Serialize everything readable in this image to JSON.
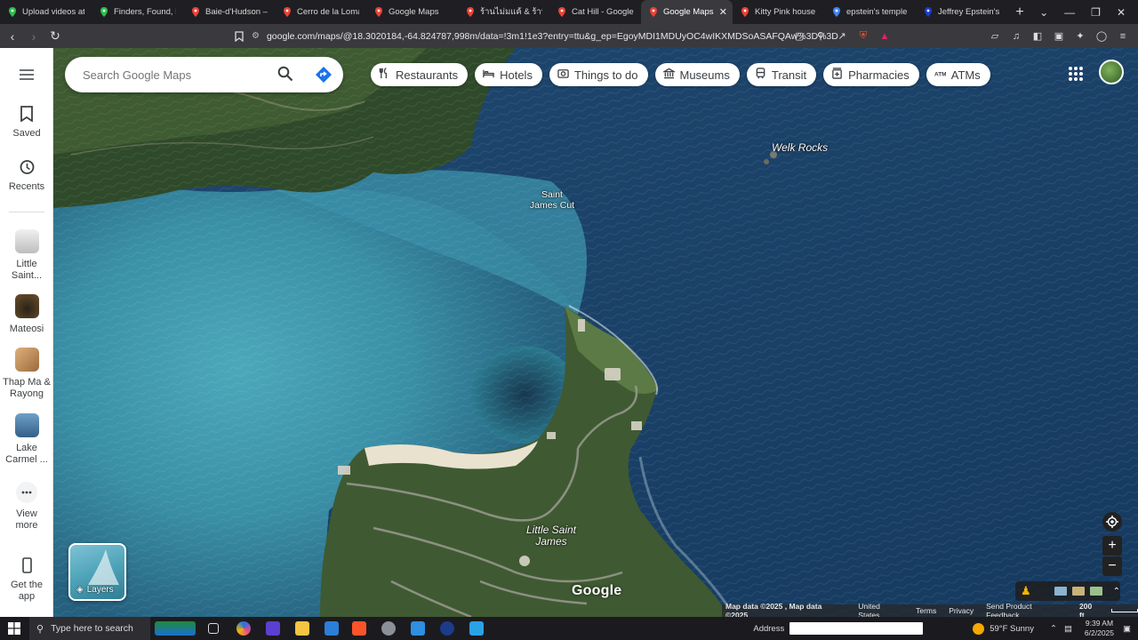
{
  "browser": {
    "tabs": [
      {
        "title": "Upload videos at R",
        "icon_color": "#2fbf4a"
      },
      {
        "title": "Finders, Found, Fur",
        "icon_color": "#2fbf4a"
      },
      {
        "title": "Baie-d'Hudson – Go",
        "icon_color": "#ea4335"
      },
      {
        "title": "Cerro de la Loma L",
        "icon_color": "#ea4335"
      },
      {
        "title": "Google Maps",
        "icon_color": "#ea4335"
      },
      {
        "title": "ร้านไม่มแค้ & ร้านเหล",
        "icon_color": "#ea4335"
      },
      {
        "title": "Cat Hill - Google M",
        "icon_color": "#ea4335"
      },
      {
        "title": "Google Maps",
        "icon_color": "#ea4335",
        "active": true
      },
      {
        "title": "Kitty Pink house - G",
        "icon_color": "#ea4335"
      },
      {
        "title": "epstein's temple - G",
        "icon_color": "#4285f4"
      },
      {
        "title": "Jeffrey Epstein's Pri",
        "icon_color": "#1a3ccf"
      }
    ],
    "new_tab": "+",
    "url": "google.com/maps/@18.3020184,-64.824787,998m/data=!3m1!1e3?entry=ttu&g_ep=EgoyMDI1MDUyOC4wIKXMDSoASAFQAw%3D%3D"
  },
  "sidebar": {
    "menu_icon": "hamburger-icon",
    "items": [
      {
        "label": "Saved",
        "icon": "bookmark-icon"
      },
      {
        "label": "Recents",
        "icon": "history-icon"
      },
      {
        "label": "Little Saint...",
        "thumb_color": "#c9c9c9"
      },
      {
        "label": "Mateosi",
        "thumb_color": "#6b4f2e"
      },
      {
        "label": "Thap Ma & Rayong",
        "thumb_color": "#c98f55"
      },
      {
        "label": "Lake Carmel ...",
        "thumb_color": "#4c7fa8"
      },
      {
        "label": "View more",
        "icon": "more-horiz-icon"
      },
      {
        "label": "Get the app",
        "icon": "phone-icon"
      }
    ]
  },
  "search": {
    "placeholder": "Search Google Maps"
  },
  "chips": [
    {
      "label": "Restaurants",
      "icon": "fork-knife-icon"
    },
    {
      "label": "Hotels",
      "icon": "bed-icon"
    },
    {
      "label": "Things to do",
      "icon": "camera-icon"
    },
    {
      "label": "Museums",
      "icon": "museum-icon"
    },
    {
      "label": "Transit",
      "icon": "train-icon"
    },
    {
      "label": "Pharmacies",
      "icon": "medicine-icon"
    },
    {
      "label": "ATMs",
      "icon": "atm-icon"
    }
  ],
  "map": {
    "labels": {
      "welk_rocks": "Welk Rocks",
      "saint_james_cut_line1": "Saint",
      "saint_james_cut_line2": "James Cut",
      "little_saint_james_line1": "Little Saint",
      "little_saint_james_line2": "James"
    },
    "layers_label": "Layers",
    "logo": "Google",
    "footer": {
      "map_data": "Map data ©2025 , Map data ©2025",
      "country": "United States",
      "terms": "Terms",
      "privacy": "Privacy",
      "feedback": "Send Product Feedback",
      "scale": "200 ft"
    }
  },
  "taskbar": {
    "search_placeholder": "Type here to search",
    "address_label": "Address",
    "weather": "59°F  Sunny",
    "time": "9:39 AM",
    "date": "6/2/2025"
  }
}
